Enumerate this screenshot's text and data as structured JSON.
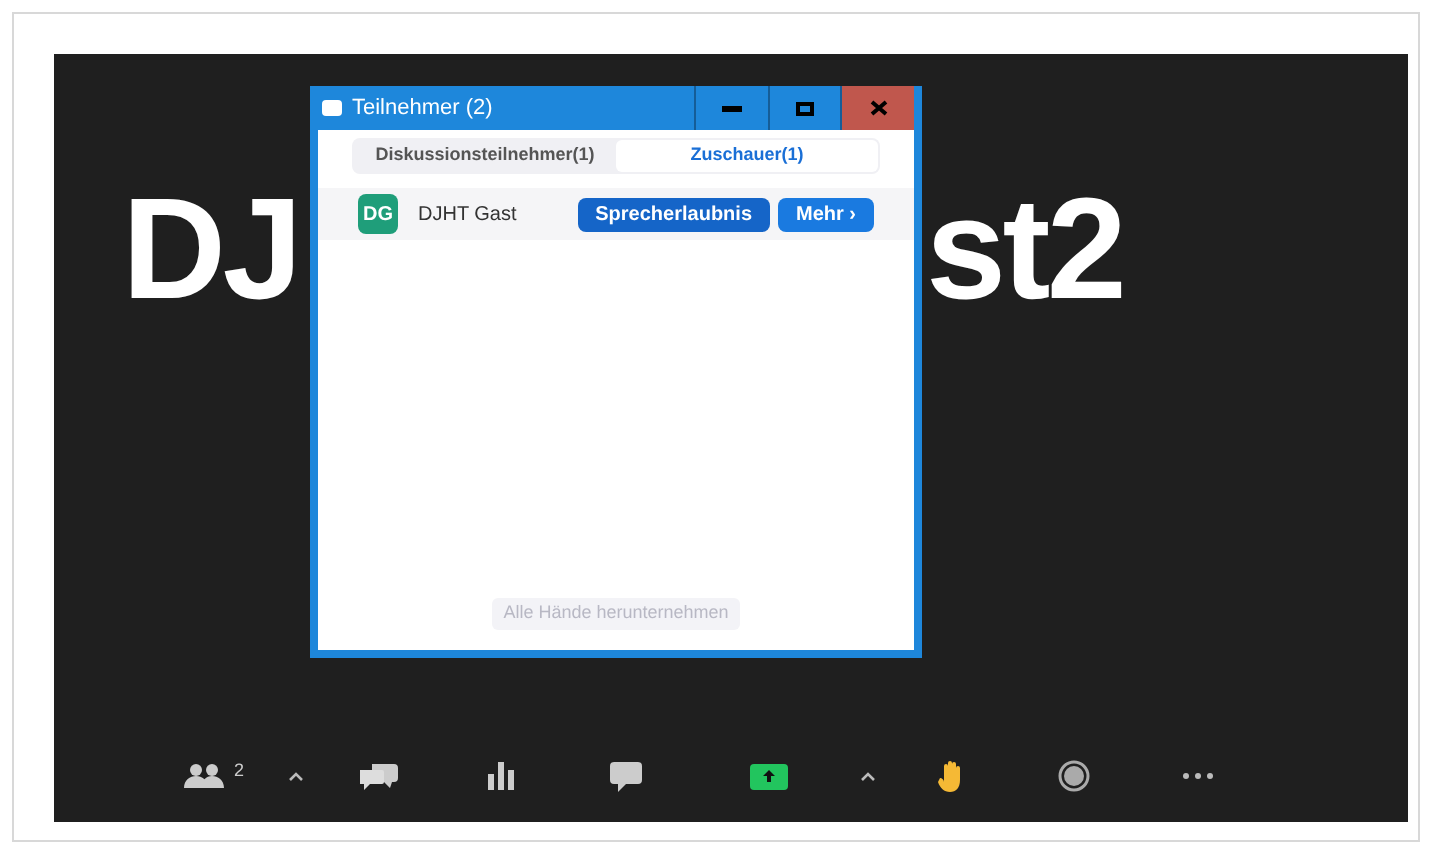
{
  "video": {
    "name_fragments": [
      "DJ",
      "st2"
    ]
  },
  "window": {
    "title": "Teilnehmer (2)",
    "controls": [
      {
        "kind": "minimize"
      },
      {
        "kind": "maximize"
      },
      {
        "kind": "close"
      }
    ]
  },
  "tabs": [
    {
      "label": "Diskussionsteilnehmer(1)",
      "selected": false
    },
    {
      "label": "Zuschauer(1)",
      "selected": true
    }
  ],
  "participants": [
    {
      "initials": "DG",
      "color": "#1f9e7a",
      "name": "DJHT Gast",
      "buttons": [
        "Sprecherlaubnis",
        "Mehr ›"
      ]
    }
  ],
  "footer_button": {
    "label": "Alle Hände herunternehmen",
    "disabled": true
  },
  "toolbar": [
    {
      "kind": "participants",
      "badge": "2"
    },
    {
      "kind": "caret"
    },
    {
      "kind": "qa"
    },
    {
      "kind": "polls"
    },
    {
      "kind": "chat"
    },
    {
      "kind": "share"
    },
    {
      "kind": "caret"
    },
    {
      "kind": "hand"
    },
    {
      "kind": "record"
    },
    {
      "kind": "more"
    }
  ]
}
